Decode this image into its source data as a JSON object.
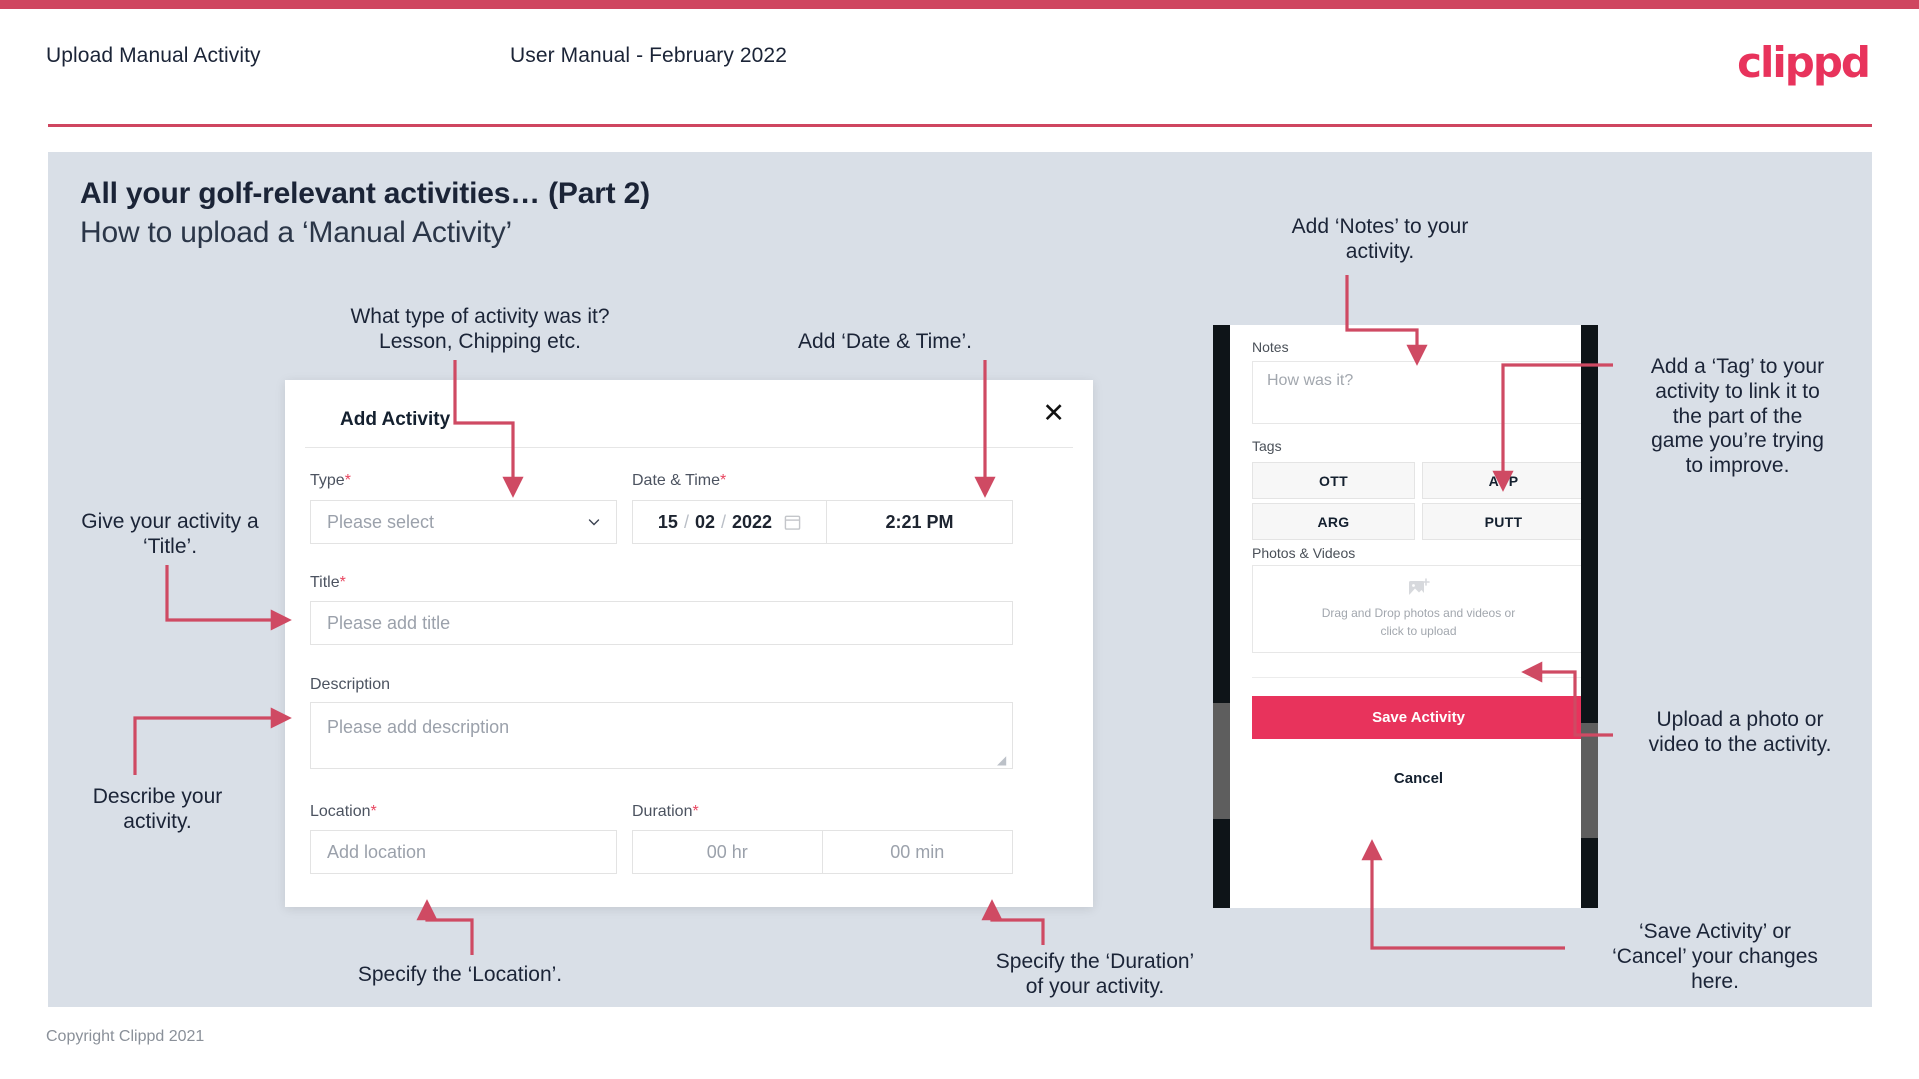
{
  "header": {
    "title": "Upload Manual Activity",
    "subtitle": "User Manual - February 2022",
    "logo": "clippd"
  },
  "slide": {
    "heading_bold": "All your golf-relevant activities… (Part 2)",
    "heading_light": "How to upload a ‘Manual Activity’"
  },
  "dialog": {
    "title": "Add Activity",
    "close_icon": "close-icon",
    "type": {
      "label": "Type",
      "required": "*",
      "placeholder": "Please select"
    },
    "datetime": {
      "label": "Date & Time",
      "required": "*",
      "day": "15",
      "month": "02",
      "year": "2022",
      "sep": "/",
      "time": "2:21 PM"
    },
    "title_field": {
      "label": "Title",
      "required": "*",
      "placeholder": "Please add title"
    },
    "description": {
      "label": "Description",
      "placeholder": "Please add description"
    },
    "location": {
      "label": "Location",
      "required": "*",
      "placeholder": "Add location"
    },
    "duration": {
      "label": "Duration",
      "required": "*",
      "hours": "00 hr",
      "minutes": "00 min"
    }
  },
  "phone": {
    "notes": {
      "label": "Notes",
      "placeholder": "How was it?"
    },
    "tags": {
      "label": "Tags",
      "items": [
        "OTT",
        "APP",
        "ARG",
        "PUTT"
      ]
    },
    "photos": {
      "label": "Photos & Videos",
      "drop_line1": "Drag and Drop photos and videos or",
      "drop_line2": "click to upload"
    },
    "save_label": "Save Activity",
    "cancel_label": "Cancel"
  },
  "annotations": {
    "type": "What type of activity was it?\nLesson, Chipping etc.",
    "datetime": "Add ‘Date & Time’.",
    "title": "Give your activity a\n‘Title’.",
    "description": "Describe your\nactivity.",
    "location": "Specify the ‘Location’.",
    "duration": "Specify the ‘Duration’\nof your activity.",
    "notes": "Add ‘Notes’ to your\nactivity.",
    "tags": "Add a ‘Tag’ to your\nactivity to link it to\nthe part of the\ngame you’re trying\nto improve.",
    "upload": "Upload a photo or\nvideo to the activity.",
    "save": "‘Save Activity’ or\n‘Cancel’ your changes\nhere."
  },
  "footer": {
    "copyright": "Copyright Clippd 2021"
  },
  "colors": {
    "accent": "#cf4660",
    "brand": "#e8335c",
    "slide_bg": "#d9dfe7",
    "text": "#1b2437",
    "arrow": "#cf4a63"
  }
}
